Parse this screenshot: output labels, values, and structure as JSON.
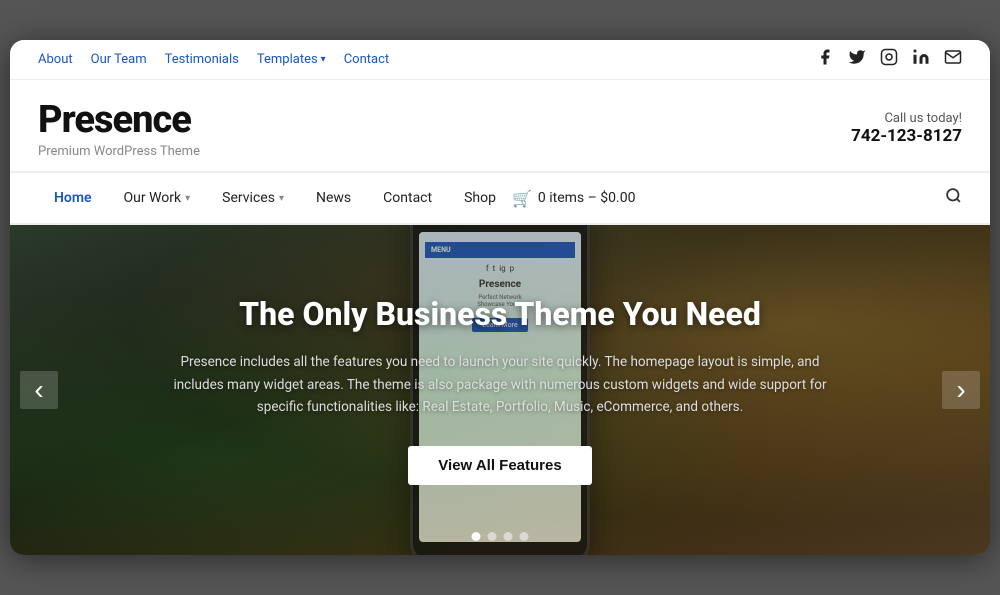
{
  "topNav": {
    "links": [
      {
        "label": "About",
        "href": "#",
        "active": false
      },
      {
        "label": "Our Team",
        "href": "#",
        "active": false
      },
      {
        "label": "Testimonials",
        "href": "#",
        "active": false
      },
      {
        "label": "Templates",
        "href": "#",
        "active": false,
        "hasDropdown": true
      },
      {
        "label": "Contact",
        "href": "#",
        "active": false
      }
    ],
    "socialIcons": [
      {
        "name": "facebook-icon",
        "glyph": "f"
      },
      {
        "name": "twitter-icon",
        "glyph": "t"
      },
      {
        "name": "instagram-icon",
        "glyph": "i"
      },
      {
        "name": "linkedin-icon",
        "glyph": "in"
      },
      {
        "name": "email-icon",
        "glyph": "✉"
      }
    ]
  },
  "brand": {
    "name": "Presence",
    "tagline": "Premium WordPress Theme",
    "callLabel": "Call us today!",
    "callNumber": "742-123-8127"
  },
  "mainNav": {
    "links": [
      {
        "label": "Home",
        "href": "#",
        "active": true,
        "hasDropdown": false
      },
      {
        "label": "Our Work",
        "href": "#",
        "active": false,
        "hasDropdown": true
      },
      {
        "label": "Services",
        "href": "#",
        "active": false,
        "hasDropdown": true
      },
      {
        "label": "News",
        "href": "#",
        "active": false,
        "hasDropdown": false
      },
      {
        "label": "Contact",
        "href": "#",
        "active": false,
        "hasDropdown": false
      },
      {
        "label": "Shop",
        "href": "#",
        "active": false,
        "hasDropdown": false
      }
    ],
    "cart": {
      "icon": "🛒",
      "text": "0 items – $0.00"
    },
    "searchLabel": "search"
  },
  "hero": {
    "title": "The Only Business Theme You Need",
    "description": "Presence includes all the features you need to launch your site quickly. The homepage layout is simple, and includes many widget areas. The theme is also package with numerous custom widgets and wide support for specific functionalities like: Real Estate, Portfolio, Music, eCommerce, and others.",
    "buttonLabel": "View All Features",
    "dots": [
      {
        "active": true
      },
      {
        "active": false
      },
      {
        "active": false
      },
      {
        "active": false
      }
    ],
    "prevArrow": "‹",
    "nextArrow": "›"
  },
  "phone": {
    "menuLabel": "MENU",
    "logoText": "Presence",
    "socialGlyphs": [
      "f",
      "t",
      "ig",
      "p"
    ]
  }
}
